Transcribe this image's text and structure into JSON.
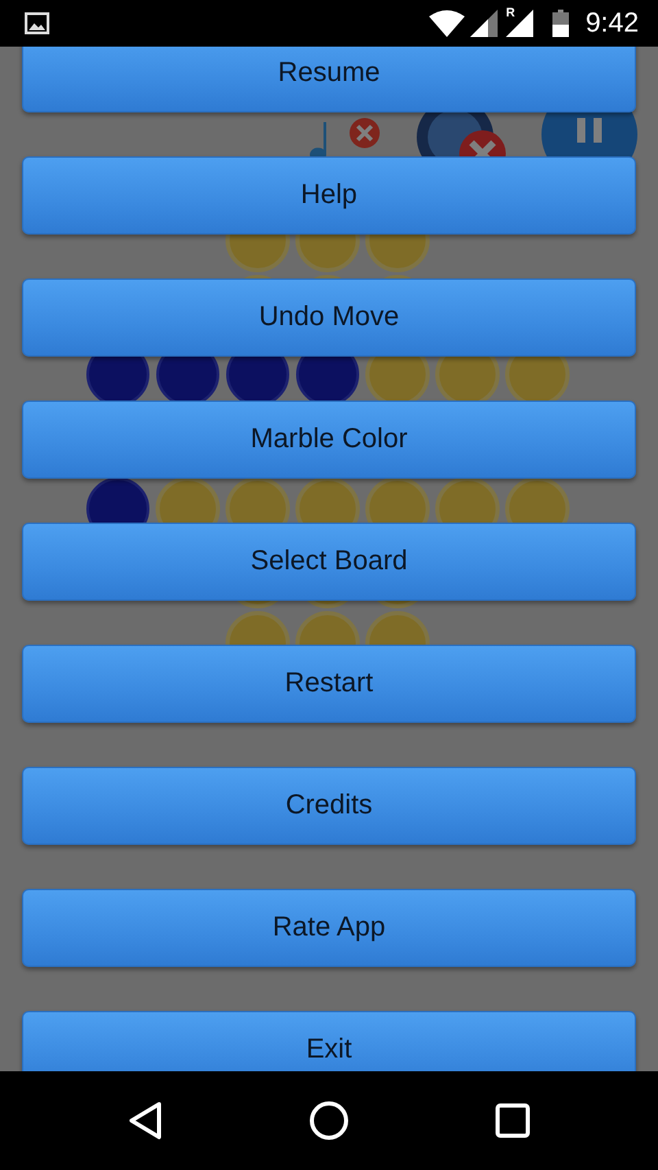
{
  "status_bar": {
    "roaming_indicator": "R",
    "time": "9:42"
  },
  "game": {
    "music": {
      "muted": true
    },
    "sound": {
      "muted": true
    },
    "board": {
      "rows": [
        {
          "cells": [
            {
              "kind": "hole"
            },
            {
              "kind": "hole"
            },
            {
              "kind": "hole"
            }
          ]
        },
        {
          "cells": [
            {
              "kind": "hole"
            },
            {
              "kind": "hole"
            },
            {
              "kind": "hole"
            }
          ]
        },
        {
          "cells": [
            {
              "kind": "marble"
            },
            {
              "kind": "marble"
            },
            {
              "kind": "marble"
            },
            {
              "kind": "marble"
            },
            {
              "kind": "hole"
            },
            {
              "kind": "hole"
            },
            {
              "kind": "hole"
            }
          ]
        },
        {
          "cells": [
            {
              "kind": "marble"
            },
            {
              "kind": "hole"
            },
            {
              "kind": "hole"
            },
            {
              "kind": "hole"
            },
            {
              "kind": "hole"
            },
            {
              "kind": "hole"
            },
            {
              "kind": "hole"
            }
          ]
        },
        {
          "cells": [
            {
              "kind": "hole"
            },
            {
              "kind": "hole"
            },
            {
              "kind": "hole"
            }
          ]
        },
        {
          "cells": [
            {
              "kind": "hole"
            },
            {
              "kind": "hole"
            },
            {
              "kind": "hole"
            }
          ]
        }
      ]
    }
  },
  "menu": {
    "items": [
      "Resume",
      "Help",
      "Undo Move",
      "Marble Color",
      "Select Board",
      "Restart",
      "Credits",
      "Rate App",
      "Exit"
    ]
  }
}
